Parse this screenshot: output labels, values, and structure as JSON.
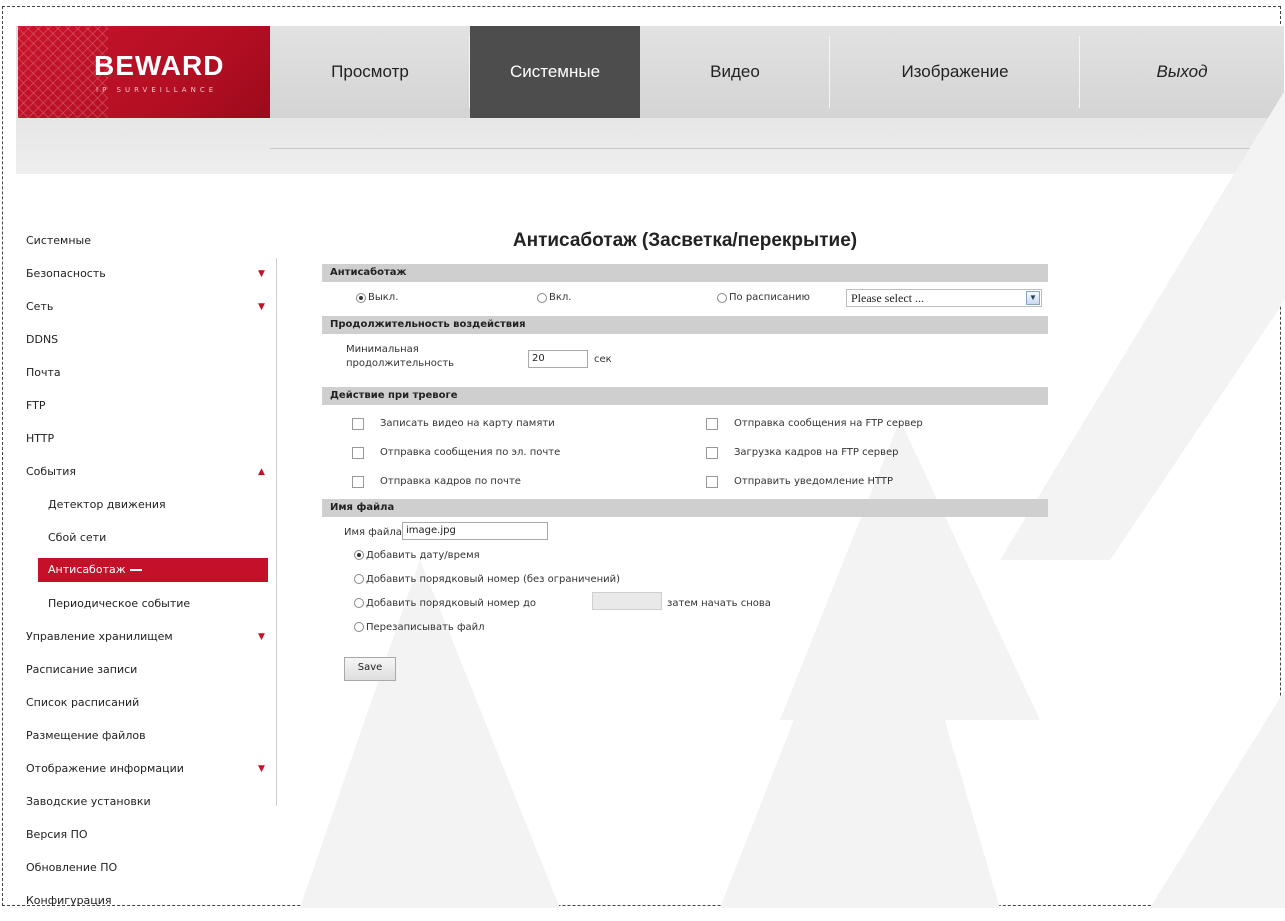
{
  "brand": {
    "logo": "BEWARD",
    "logo_sub": "IP SURVEILLANCE"
  },
  "nav": {
    "view": "Просмотр",
    "system": "Системные",
    "video": "Видео",
    "image": "Изображение",
    "logout": "Выход"
  },
  "sidebar": {
    "items": [
      {
        "label": "Системные"
      },
      {
        "label": "Безопасность",
        "arrow": "▼"
      },
      {
        "label": "Сеть",
        "arrow": "▼"
      },
      {
        "label": "DDNS"
      },
      {
        "label": "Почта"
      },
      {
        "label": "FTP"
      },
      {
        "label": "HTTP"
      },
      {
        "label": "События",
        "arrow": "▲"
      },
      {
        "label": "Детектор движения"
      },
      {
        "label": "Сбой сети"
      },
      {
        "label": "Антисаботаж"
      },
      {
        "label": "Периодическое событие"
      },
      {
        "label": "Управление хранилищем",
        "arrow": "▼"
      },
      {
        "label": "Расписание записи"
      },
      {
        "label": "Список расписаний"
      },
      {
        "label": "Размещение файлов"
      },
      {
        "label": "Отображение информации",
        "arrow": "▼"
      },
      {
        "label": "Заводские установки"
      },
      {
        "label": "Версия ПО"
      },
      {
        "label": "Обновление ПО"
      },
      {
        "label": "Конфигурация"
      }
    ]
  },
  "main": {
    "title": "Антисаботаж (Засветка/перекрытие)",
    "tamper": {
      "header": "Антисаботаж",
      "off": "Выкл.",
      "on": "Вкл.",
      "schedule": "По расписанию",
      "schedule_select": "Please select ...",
      "selected": "off"
    },
    "duration": {
      "header": "Продолжительность воздействия",
      "label_line1": "Минимальная",
      "label_line2": "продолжительность",
      "value": "20",
      "unit": "сек"
    },
    "actions": {
      "header": "Действие при тревоге",
      "left": [
        "Записать видео на карту памяти",
        "Отправка сообщения по эл. почте",
        "Отправка кадров по почте"
      ],
      "right": [
        "Отправка сообщения на FTP сервер",
        "Загрузка кадров на FTP сервер",
        "Отправить уведомление HTTP"
      ]
    },
    "filename": {
      "header": "Имя файла",
      "label": "Имя файла:",
      "value": "image.jpg",
      "opt_datetime": "Добавить дату/время",
      "opt_seq_unlimited": "Добавить порядковый номер (без ограничений)",
      "opt_seq_upto": "Добавить порядковый номер до",
      "opt_seq_upto_value": "",
      "opt_seq_upto_suffix": "затем начать снова",
      "opt_overwrite": "Перезаписывать файл",
      "selected": "datetime"
    },
    "save_label": "Save"
  },
  "colors": {
    "accent": "#c5102a",
    "active_tab": "#4d4d4d",
    "section_bar": "#cfcfcf"
  },
  "watermark": {
    "text": "BEWARD",
    "color": "#f6f6f6"
  }
}
